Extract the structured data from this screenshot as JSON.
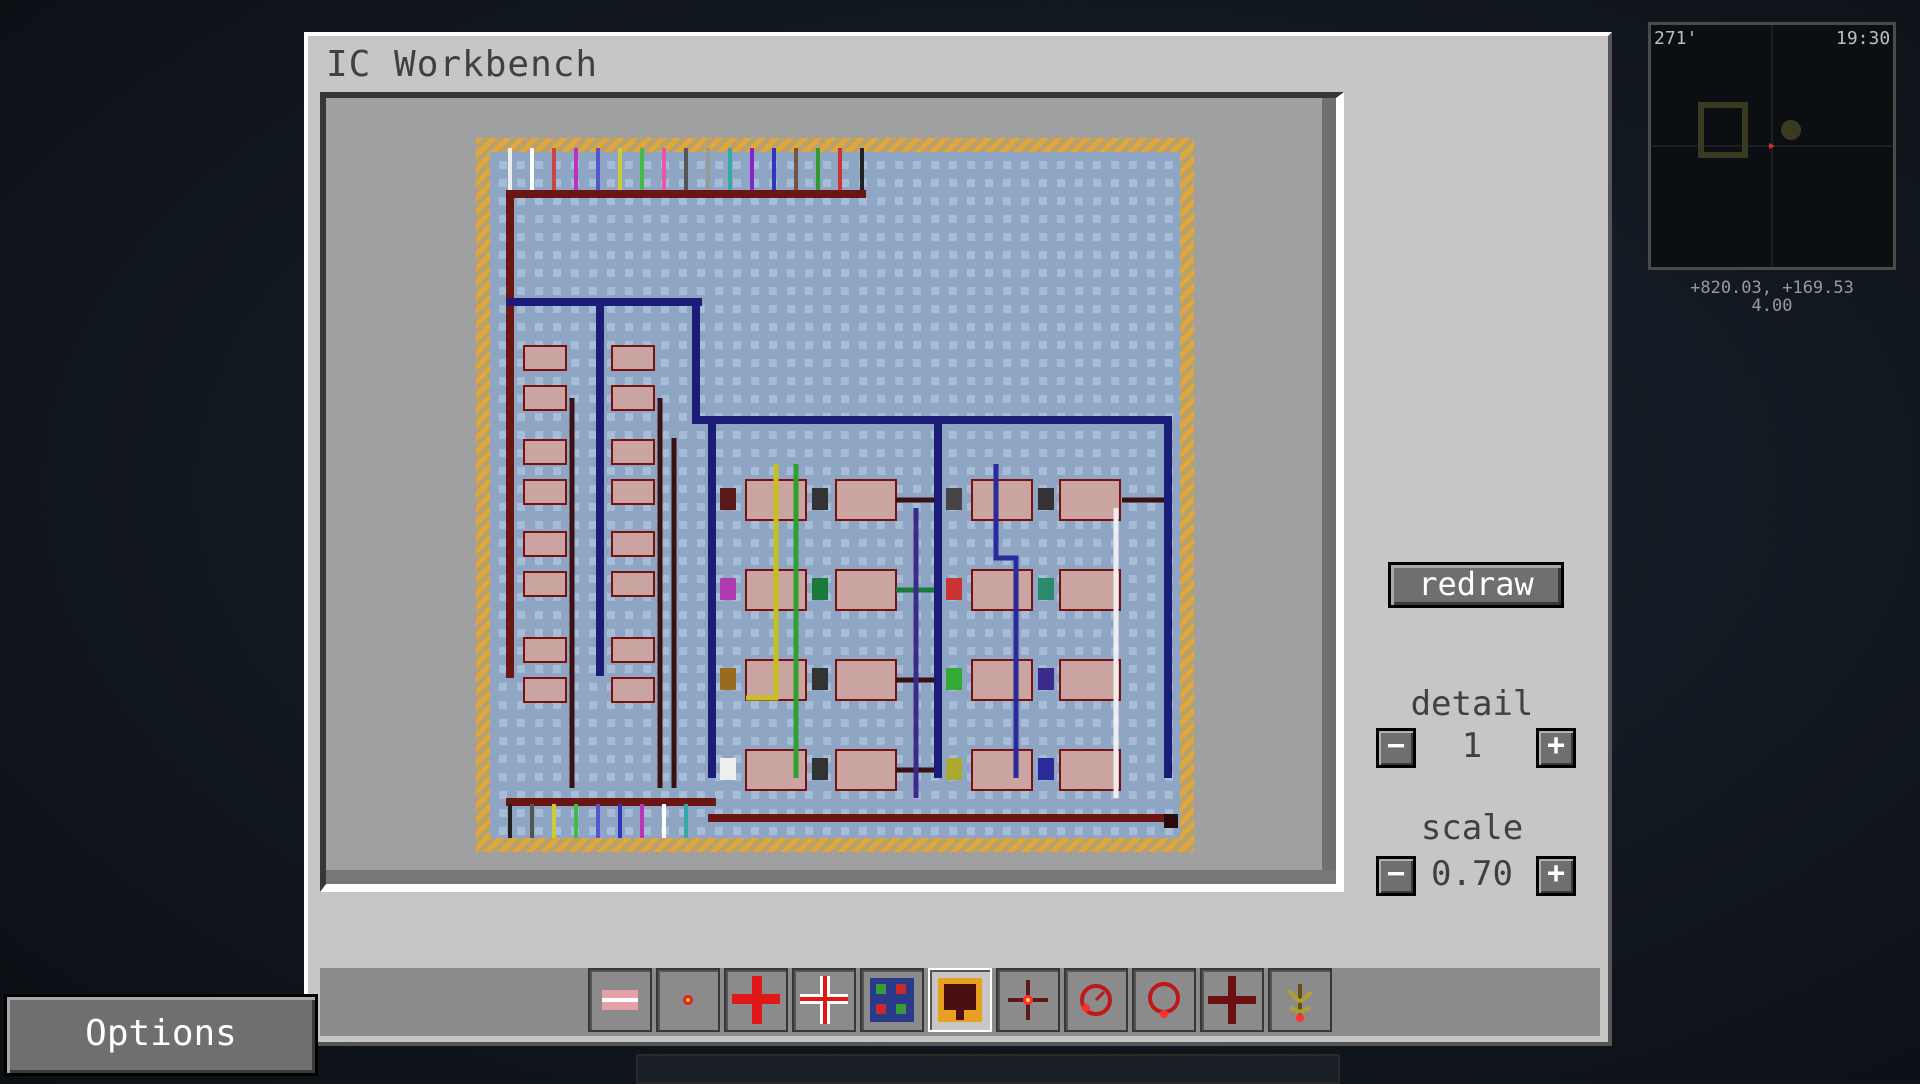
{
  "window": {
    "title": "IC Workbench"
  },
  "right_panel": {
    "redraw_label": "redraw",
    "detail_label": "detail",
    "detail_value": "1",
    "scale_label": "scale",
    "scale_value": "0.70",
    "minus_glyph": "−",
    "plus_glyph": "+"
  },
  "palette": [
    {
      "icon": "eraser-icon",
      "selected": false
    },
    {
      "icon": "redstone-dot-icon",
      "selected": false
    },
    {
      "icon": "red-cross-wire-icon",
      "selected": false
    },
    {
      "icon": "insulated-cross-wire-icon",
      "selected": false
    },
    {
      "icon": "bundled-cable-icon",
      "selected": false
    },
    {
      "icon": "io-gate-icon",
      "selected": true
    },
    {
      "icon": "torch-gate-icon",
      "selected": false
    },
    {
      "icon": "timer-gate-icon",
      "selected": false
    },
    {
      "icon": "repeater-ring-icon",
      "selected": false
    },
    {
      "icon": "cross-wire-dark-icon",
      "selected": false
    },
    {
      "icon": "plant-gate-icon",
      "selected": false
    }
  ],
  "options_label": "Options",
  "minimap": {
    "heading": "271'",
    "time": "19:30",
    "coords": "+820.03, +169.53",
    "zoom": "4.00"
  },
  "colors": {
    "panel": "#c6c6c6",
    "board_bg": "#8fa7c6",
    "border_hatch": "#d9a33a",
    "wire_red": "#7a1010",
    "wire_blue": "#1a1a80"
  }
}
